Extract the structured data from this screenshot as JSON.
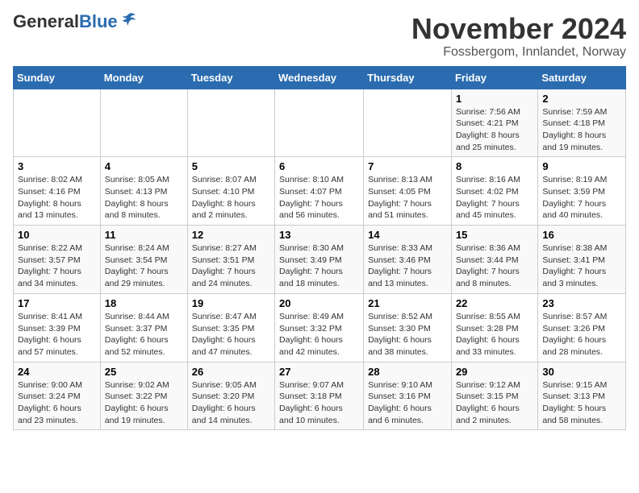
{
  "logo": {
    "general": "General",
    "blue": "Blue"
  },
  "header": {
    "month": "November 2024",
    "location": "Fossbergom, Innlandet, Norway"
  },
  "weekdays": [
    "Sunday",
    "Monday",
    "Tuesday",
    "Wednesday",
    "Thursday",
    "Friday",
    "Saturday"
  ],
  "weeks": [
    [
      {
        "day": "",
        "detail": ""
      },
      {
        "day": "",
        "detail": ""
      },
      {
        "day": "",
        "detail": ""
      },
      {
        "day": "",
        "detail": ""
      },
      {
        "day": "",
        "detail": ""
      },
      {
        "day": "1",
        "detail": "Sunrise: 7:56 AM\nSunset: 4:21 PM\nDaylight: 8 hours and 25 minutes."
      },
      {
        "day": "2",
        "detail": "Sunrise: 7:59 AM\nSunset: 4:18 PM\nDaylight: 8 hours and 19 minutes."
      }
    ],
    [
      {
        "day": "3",
        "detail": "Sunrise: 8:02 AM\nSunset: 4:16 PM\nDaylight: 8 hours and 13 minutes."
      },
      {
        "day": "4",
        "detail": "Sunrise: 8:05 AM\nSunset: 4:13 PM\nDaylight: 8 hours and 8 minutes."
      },
      {
        "day": "5",
        "detail": "Sunrise: 8:07 AM\nSunset: 4:10 PM\nDaylight: 8 hours and 2 minutes."
      },
      {
        "day": "6",
        "detail": "Sunrise: 8:10 AM\nSunset: 4:07 PM\nDaylight: 7 hours and 56 minutes."
      },
      {
        "day": "7",
        "detail": "Sunrise: 8:13 AM\nSunset: 4:05 PM\nDaylight: 7 hours and 51 minutes."
      },
      {
        "day": "8",
        "detail": "Sunrise: 8:16 AM\nSunset: 4:02 PM\nDaylight: 7 hours and 45 minutes."
      },
      {
        "day": "9",
        "detail": "Sunrise: 8:19 AM\nSunset: 3:59 PM\nDaylight: 7 hours and 40 minutes."
      }
    ],
    [
      {
        "day": "10",
        "detail": "Sunrise: 8:22 AM\nSunset: 3:57 PM\nDaylight: 7 hours and 34 minutes."
      },
      {
        "day": "11",
        "detail": "Sunrise: 8:24 AM\nSunset: 3:54 PM\nDaylight: 7 hours and 29 minutes."
      },
      {
        "day": "12",
        "detail": "Sunrise: 8:27 AM\nSunset: 3:51 PM\nDaylight: 7 hours and 24 minutes."
      },
      {
        "day": "13",
        "detail": "Sunrise: 8:30 AM\nSunset: 3:49 PM\nDaylight: 7 hours and 18 minutes."
      },
      {
        "day": "14",
        "detail": "Sunrise: 8:33 AM\nSunset: 3:46 PM\nDaylight: 7 hours and 13 minutes."
      },
      {
        "day": "15",
        "detail": "Sunrise: 8:36 AM\nSunset: 3:44 PM\nDaylight: 7 hours and 8 minutes."
      },
      {
        "day": "16",
        "detail": "Sunrise: 8:38 AM\nSunset: 3:41 PM\nDaylight: 7 hours and 3 minutes."
      }
    ],
    [
      {
        "day": "17",
        "detail": "Sunrise: 8:41 AM\nSunset: 3:39 PM\nDaylight: 6 hours and 57 minutes."
      },
      {
        "day": "18",
        "detail": "Sunrise: 8:44 AM\nSunset: 3:37 PM\nDaylight: 6 hours and 52 minutes."
      },
      {
        "day": "19",
        "detail": "Sunrise: 8:47 AM\nSunset: 3:35 PM\nDaylight: 6 hours and 47 minutes."
      },
      {
        "day": "20",
        "detail": "Sunrise: 8:49 AM\nSunset: 3:32 PM\nDaylight: 6 hours and 42 minutes."
      },
      {
        "day": "21",
        "detail": "Sunrise: 8:52 AM\nSunset: 3:30 PM\nDaylight: 6 hours and 38 minutes."
      },
      {
        "day": "22",
        "detail": "Sunrise: 8:55 AM\nSunset: 3:28 PM\nDaylight: 6 hours and 33 minutes."
      },
      {
        "day": "23",
        "detail": "Sunrise: 8:57 AM\nSunset: 3:26 PM\nDaylight: 6 hours and 28 minutes."
      }
    ],
    [
      {
        "day": "24",
        "detail": "Sunrise: 9:00 AM\nSunset: 3:24 PM\nDaylight: 6 hours and 23 minutes."
      },
      {
        "day": "25",
        "detail": "Sunrise: 9:02 AM\nSunset: 3:22 PM\nDaylight: 6 hours and 19 minutes."
      },
      {
        "day": "26",
        "detail": "Sunrise: 9:05 AM\nSunset: 3:20 PM\nDaylight: 6 hours and 14 minutes."
      },
      {
        "day": "27",
        "detail": "Sunrise: 9:07 AM\nSunset: 3:18 PM\nDaylight: 6 hours and 10 minutes."
      },
      {
        "day": "28",
        "detail": "Sunrise: 9:10 AM\nSunset: 3:16 PM\nDaylight: 6 hours and 6 minutes."
      },
      {
        "day": "29",
        "detail": "Sunrise: 9:12 AM\nSunset: 3:15 PM\nDaylight: 6 hours and 2 minutes."
      },
      {
        "day": "30",
        "detail": "Sunrise: 9:15 AM\nSunset: 3:13 PM\nDaylight: 5 hours and 58 minutes."
      }
    ]
  ]
}
